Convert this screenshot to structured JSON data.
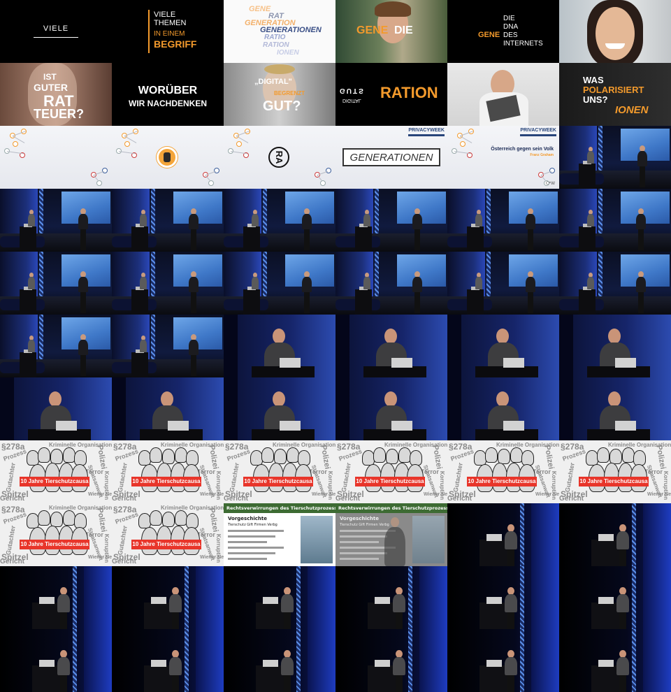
{
  "colors": {
    "accent_orange": "#f39a2c",
    "banner_red": "#e8352a",
    "slide_green": "#3d6b33",
    "navy": "#28457a"
  },
  "row0": {
    "t0": {
      "word": "VIELE"
    },
    "t1": {
      "line1": "VIELE",
      "line2": "THEMEN",
      "line3": "IN EINEM",
      "line4": "BEGRIFF"
    },
    "t2": {
      "words": [
        "GENE",
        "RAT",
        "GENERATION",
        "GENERATIONEN",
        "RATIO",
        "RATION",
        "IONEN"
      ]
    },
    "t3": {
      "left": "GENE",
      "right": "DIE"
    },
    "t4": {
      "gene": "GENE",
      "die": "DIE",
      "dna": "DNA",
      "des": "DES",
      "internets": "INTERNETS"
    }
  },
  "row1": {
    "t0": {
      "l1": "IST",
      "l2": "GUTER",
      "l3": "RAT",
      "l4": "TEUER?"
    },
    "t1": {
      "l1": "WORÜBER",
      "l2": "WIR NACHDENKEN"
    },
    "t2": {
      "l1": "„DIGITAL\"",
      "l2": "BEGRENZT",
      "l3": "GUT?"
    },
    "t3": {
      "flip1": "GUTS",
      "word": "RATION",
      "flip2": "DIGITAL"
    },
    "t5": {
      "l1": "WAS",
      "l2": "POLARISIERT",
      "l3": "UNS?",
      "l4": "IONEN"
    }
  },
  "row2": {
    "t3": {
      "word": "GENERATIONEN"
    },
    "logo": "PRIVACYWEEK",
    "cw": "C*W",
    "t4": {
      "headline": "Österreich gegen sein Volk",
      "sub": "Franz Graham"
    },
    "t2": {
      "mark": "RA"
    }
  },
  "tierschutz": {
    "banner": "10 Jahre Tierschutzcausa",
    "words": [
      "§278a",
      "Prozess",
      "Kriminelle Organisation",
      "Polizei",
      "Terror",
      "Gutachter",
      "Staatsanwalt",
      "Korruption",
      "Spitzel",
      "Gericht",
      "Wiener Neustadt"
    ]
  },
  "rv": {
    "title": "Rechtsverwirrungen des Tierschutzprozesses",
    "sub": "Vorgeschichte",
    "sub2": "Tierschutz Gift Firmen Verbg"
  }
}
